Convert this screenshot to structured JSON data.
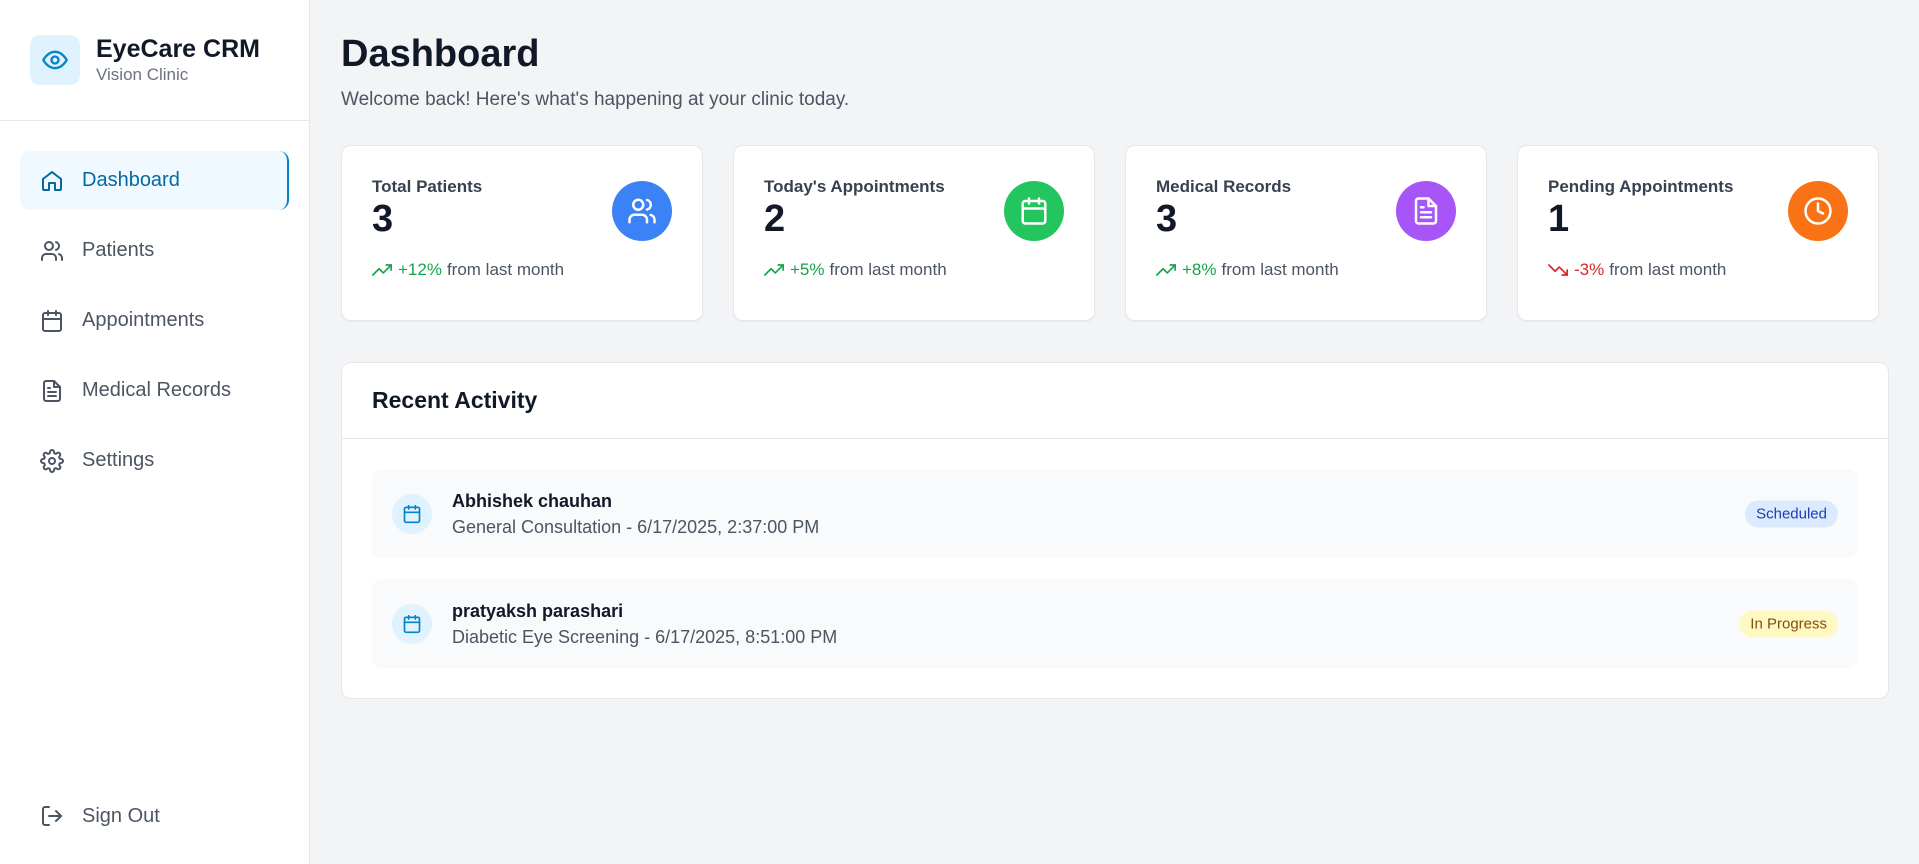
{
  "brand": {
    "title": "EyeCare CRM",
    "subtitle": "Vision Clinic"
  },
  "nav": {
    "items": [
      {
        "label": "Dashboard",
        "icon": "home-icon",
        "active": true
      },
      {
        "label": "Patients",
        "icon": "users-icon"
      },
      {
        "label": "Appointments",
        "icon": "calendar-icon"
      },
      {
        "label": "Medical Records",
        "icon": "file-text-icon"
      },
      {
        "label": "Settings",
        "icon": "gear-icon"
      }
    ],
    "signout_label": "Sign Out"
  },
  "header": {
    "title": "Dashboard",
    "subtitle": "Welcome back! Here's what's happening at your clinic today."
  },
  "stats": [
    {
      "label": "Total Patients",
      "value": "3",
      "change": "+12%",
      "suffix": "from last month",
      "direction": "up",
      "icon": "users-icon",
      "color": "#3b82f6"
    },
    {
      "label": "Today's Appointments",
      "value": "2",
      "change": "+5%",
      "suffix": "from last month",
      "direction": "up",
      "icon": "calendar-icon",
      "color": "#22c55e"
    },
    {
      "label": "Medical Records",
      "value": "3",
      "change": "+8%",
      "suffix": "from last month",
      "direction": "up",
      "icon": "file-text-icon",
      "color": "#a855f7"
    },
    {
      "label": "Pending Appointments",
      "value": "1",
      "change": "-3%",
      "suffix": "from last month",
      "direction": "down",
      "icon": "clock-icon",
      "color": "#f97316"
    }
  ],
  "activity": {
    "title": "Recent Activity",
    "items": [
      {
        "name": "Abhishek chauhan",
        "detail": "General Consultation - 6/17/2025, 2:37:00 PM",
        "status": "Scheduled",
        "status_bg": "#dbeafe",
        "status_color": "#1e40af"
      },
      {
        "name": "pratyaksh parashari",
        "detail": "Diabetic Eye Screening - 6/17/2025, 8:51:00 PM",
        "status": "In Progress",
        "status_bg": "#fef9c3",
        "status_color": "#854d0e"
      }
    ]
  },
  "colors": {
    "accent": "#0284c7",
    "up": "#16a34a",
    "down": "#dc2626"
  }
}
